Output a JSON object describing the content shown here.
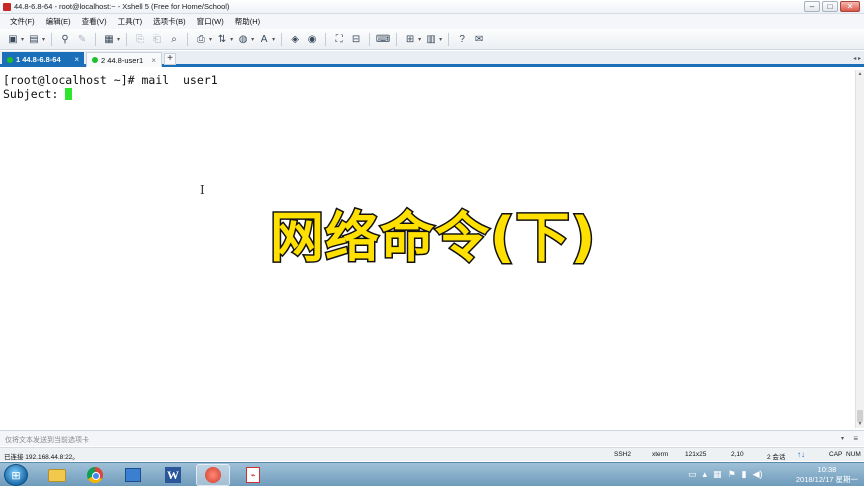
{
  "window": {
    "title": "44.8-6.8-64 - root@localhost:~ - Xshell 5 (Free for Home/School)",
    "controls": {
      "minimize": "–",
      "maximize": "□",
      "close": "✕"
    }
  },
  "menubar": {
    "items": [
      "文件(F)",
      "编辑(E)",
      "查看(V)",
      "工具(T)",
      "选项卡(B)",
      "窗口(W)",
      "帮助(H)"
    ]
  },
  "toolbar": {
    "buttons": [
      {
        "name": "new-session-icon",
        "glyph": "▣"
      },
      {
        "name": "open-folder-icon",
        "glyph": "▤"
      },
      {
        "name": "reconnect-icon",
        "glyph": "⚲"
      },
      {
        "name": "disconnect-icon",
        "glyph": "✎"
      },
      {
        "name": "properties-icon",
        "glyph": "▦"
      },
      {
        "name": "copy-icon",
        "glyph": "⎘"
      },
      {
        "name": "paste-icon",
        "glyph": "⎗"
      },
      {
        "name": "find-icon",
        "glyph": "⌕"
      },
      {
        "name": "print-icon",
        "glyph": "⎙"
      },
      {
        "name": "transfer-icon",
        "glyph": "⇅"
      },
      {
        "name": "globe-icon",
        "glyph": "◍"
      },
      {
        "name": "font-icon",
        "glyph": "A"
      },
      {
        "name": "xftp-icon",
        "glyph": "◈"
      },
      {
        "name": "script-icon",
        "glyph": "◉"
      },
      {
        "name": "fullscreen-icon",
        "glyph": "⛶"
      },
      {
        "name": "lock-icon",
        "glyph": "⊟"
      },
      {
        "name": "keyboard-icon",
        "glyph": "⌨"
      },
      {
        "name": "compose-icon",
        "glyph": "⊞"
      },
      {
        "name": "layout-icon",
        "glyph": "▥"
      },
      {
        "name": "help-icon",
        "glyph": "?"
      },
      {
        "name": "chat-icon",
        "glyph": "✉"
      }
    ]
  },
  "tabs": [
    {
      "label": "1 44.8-6.8-64",
      "close": "×"
    },
    {
      "label": "2 44.8-user1",
      "close": "×"
    }
  ],
  "tab_add": "+",
  "terminal": {
    "lines": [
      "[root@localhost ~]# mail  user1",
      "Subject: "
    ]
  },
  "overlay": {
    "title": "网络命令(下)"
  },
  "sendbar": {
    "placeholder": "仅将文本发送到当前选项卡"
  },
  "status": {
    "connection": "已连接 192.168.44.8:22。",
    "protocol": "SSH2",
    "terminal_type": "xterm",
    "size": "121x25",
    "cursor_pos": "2,10",
    "sessions": "2 会话",
    "caps": "CAP",
    "num": "NUM"
  },
  "taskbar": {
    "time": "10:38",
    "date": "2018/12/17 星期一"
  },
  "colors": {
    "accent": "#1a6fb8",
    "cursor": "#2ee62e",
    "overlay_fill": "#ffe000",
    "overlay_stroke": "#111111"
  }
}
